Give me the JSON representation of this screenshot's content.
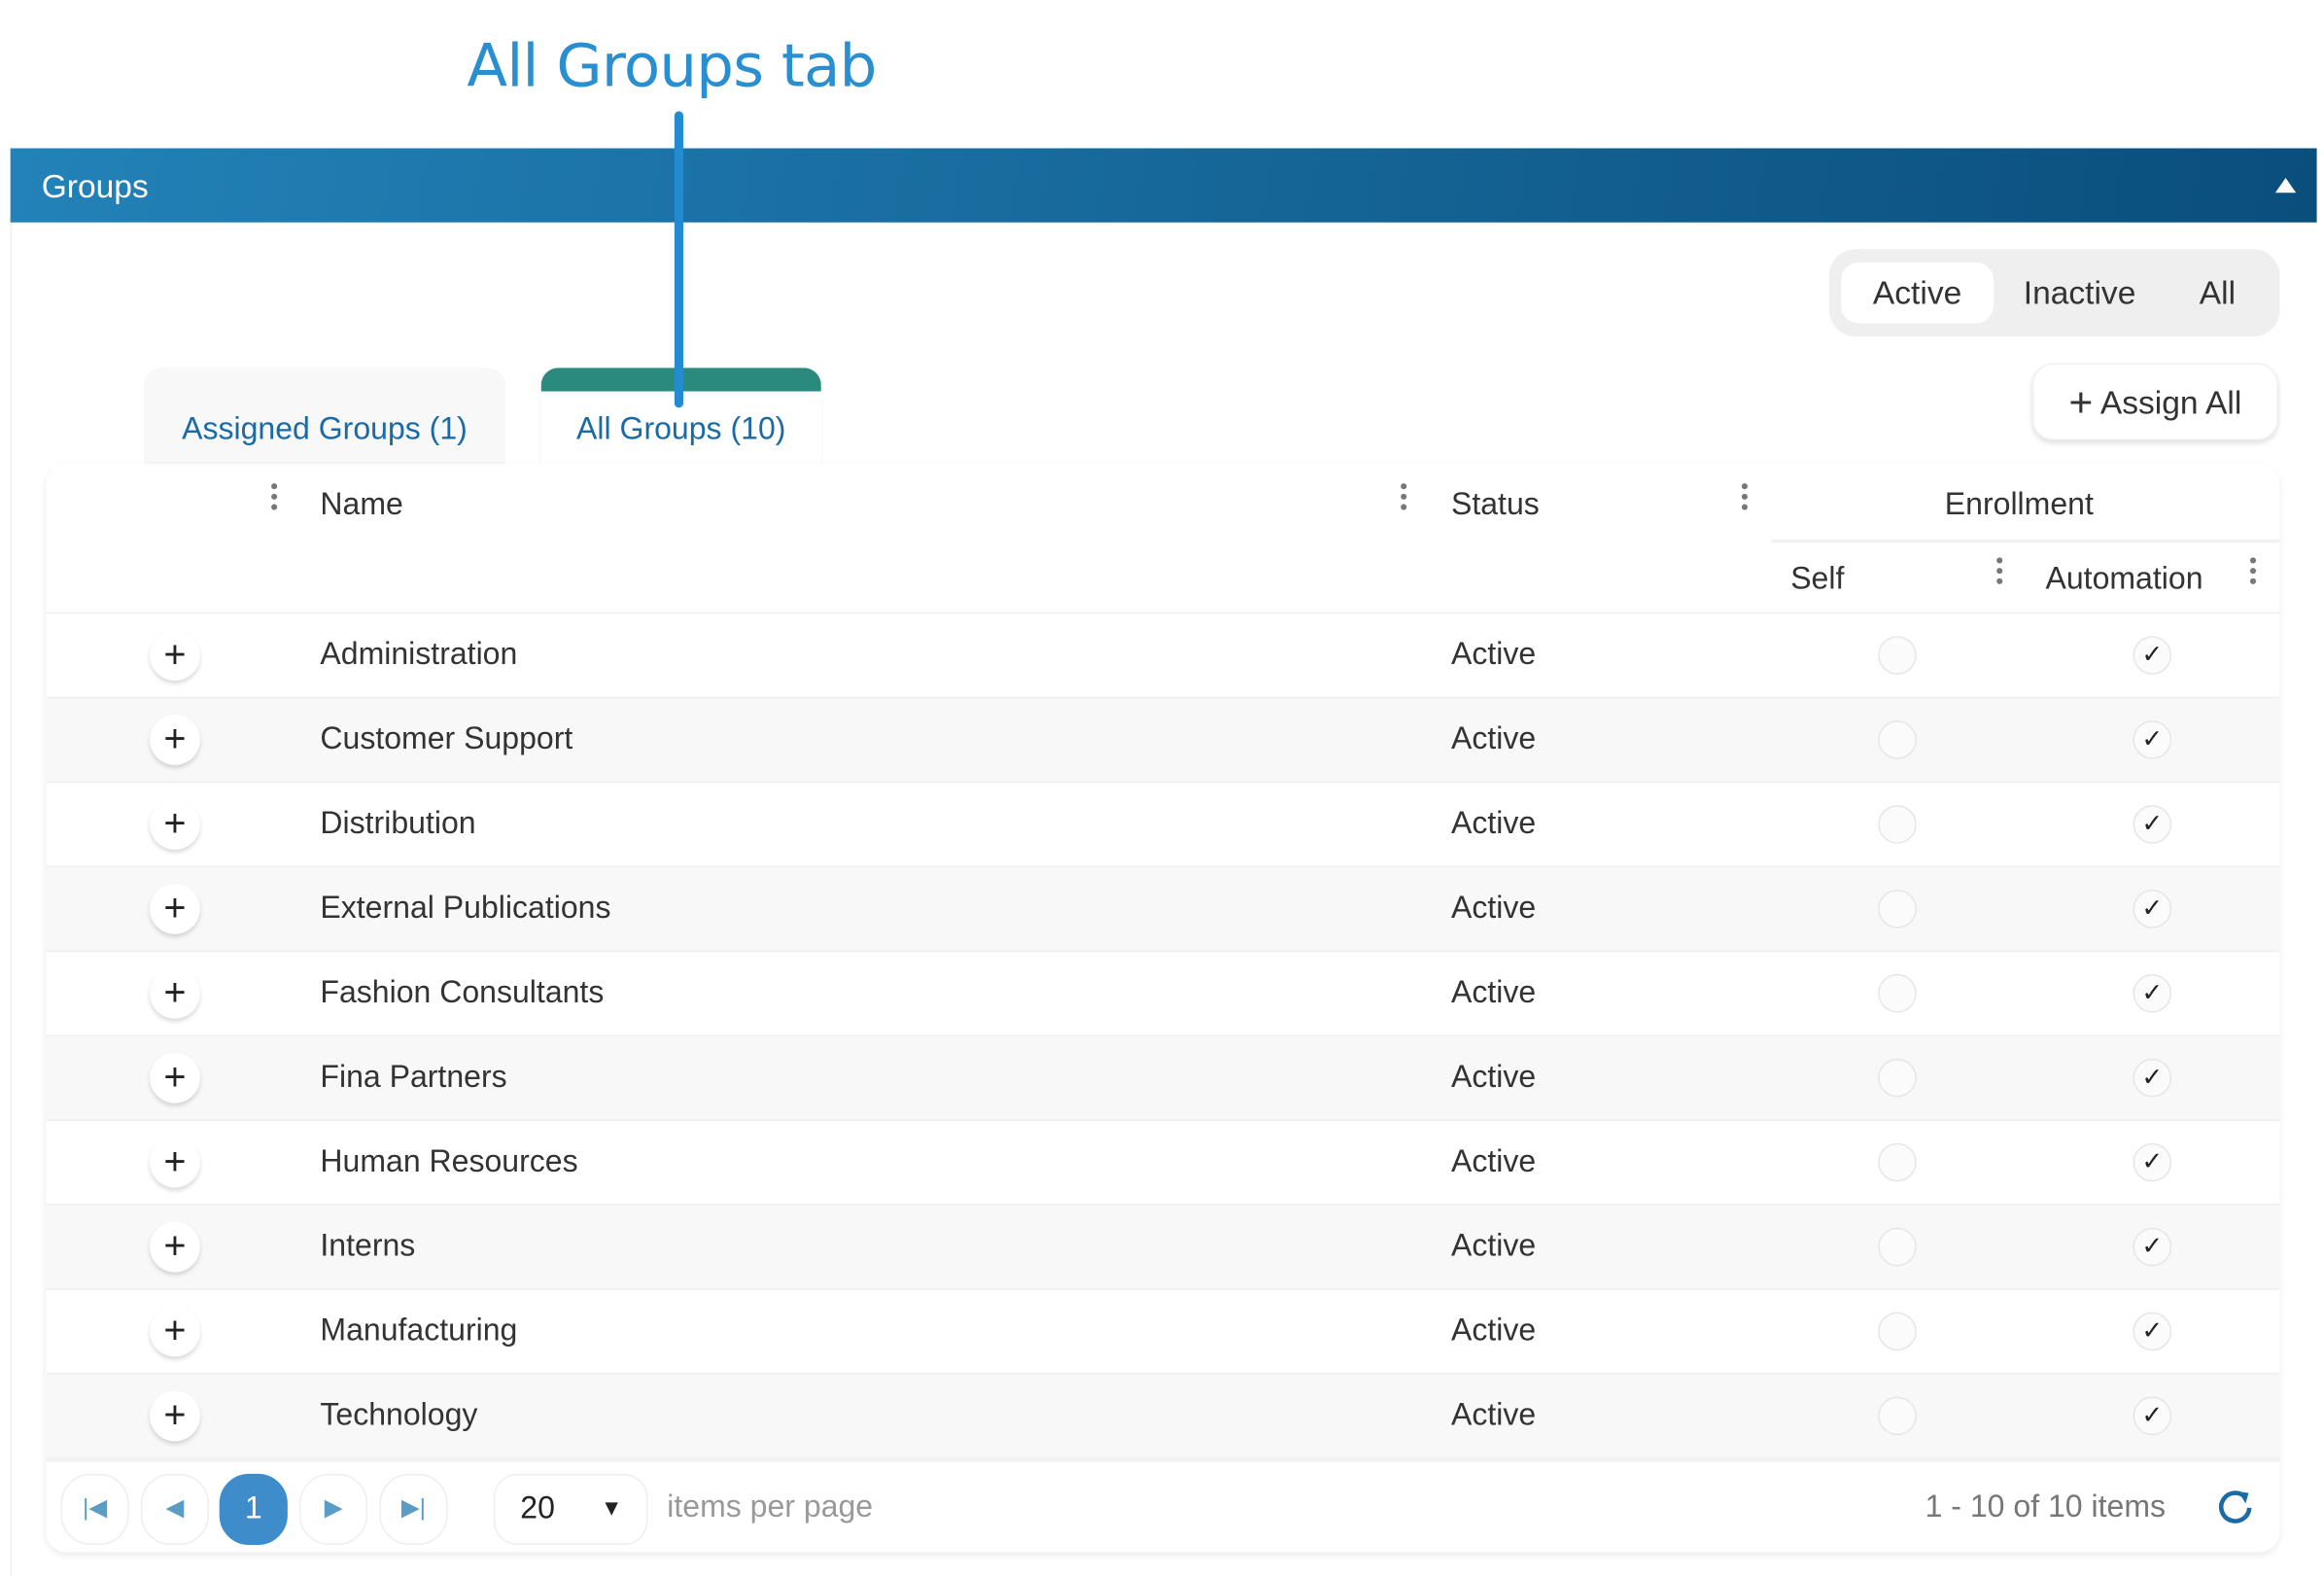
{
  "annotation": {
    "label": "All Groups tab",
    "color": "#2a8fd0"
  },
  "header": {
    "title": "Groups",
    "collapse_icon": "triangle-up-icon"
  },
  "filter": {
    "options": [
      "Active",
      "Inactive",
      "All"
    ],
    "selected": "Active"
  },
  "assign_all": {
    "label": "Assign All",
    "icon": "plus-icon"
  },
  "tabs": [
    {
      "label": "Assigned Groups (1)",
      "active": false
    },
    {
      "label": "All Groups (10)",
      "active": true
    }
  ],
  "table": {
    "columns": {
      "name": "Name",
      "status": "Status",
      "enrollment": "Enrollment",
      "self": "Self",
      "automation": "Automation"
    },
    "rows": [
      {
        "name": "Administration",
        "status": "Active",
        "self": false,
        "automation": true
      },
      {
        "name": "Customer Support",
        "status": "Active",
        "self": false,
        "automation": true
      },
      {
        "name": "Distribution",
        "status": "Active",
        "self": false,
        "automation": true
      },
      {
        "name": "External Publications",
        "status": "Active",
        "self": false,
        "automation": true
      },
      {
        "name": "Fashion Consultants",
        "status": "Active",
        "self": false,
        "automation": true
      },
      {
        "name": "Fina Partners",
        "status": "Active",
        "self": false,
        "automation": true
      },
      {
        "name": "Human Resources",
        "status": "Active",
        "self": false,
        "automation": true
      },
      {
        "name": "Interns",
        "status": "Active",
        "self": false,
        "automation": true
      },
      {
        "name": "Manufacturing",
        "status": "Active",
        "self": false,
        "automation": true
      },
      {
        "name": "Technology",
        "status": "Active",
        "self": false,
        "automation": true
      }
    ]
  },
  "pager": {
    "current_page": "1",
    "page_size": "20",
    "page_size_label": "items per page",
    "summary": "1 - 10 of 10 items"
  },
  "colors": {
    "header_start": "#2382b8",
    "header_end": "#0a4e7c",
    "tab_accent": "#2b8a7e",
    "page_active": "#3f8ccb"
  }
}
